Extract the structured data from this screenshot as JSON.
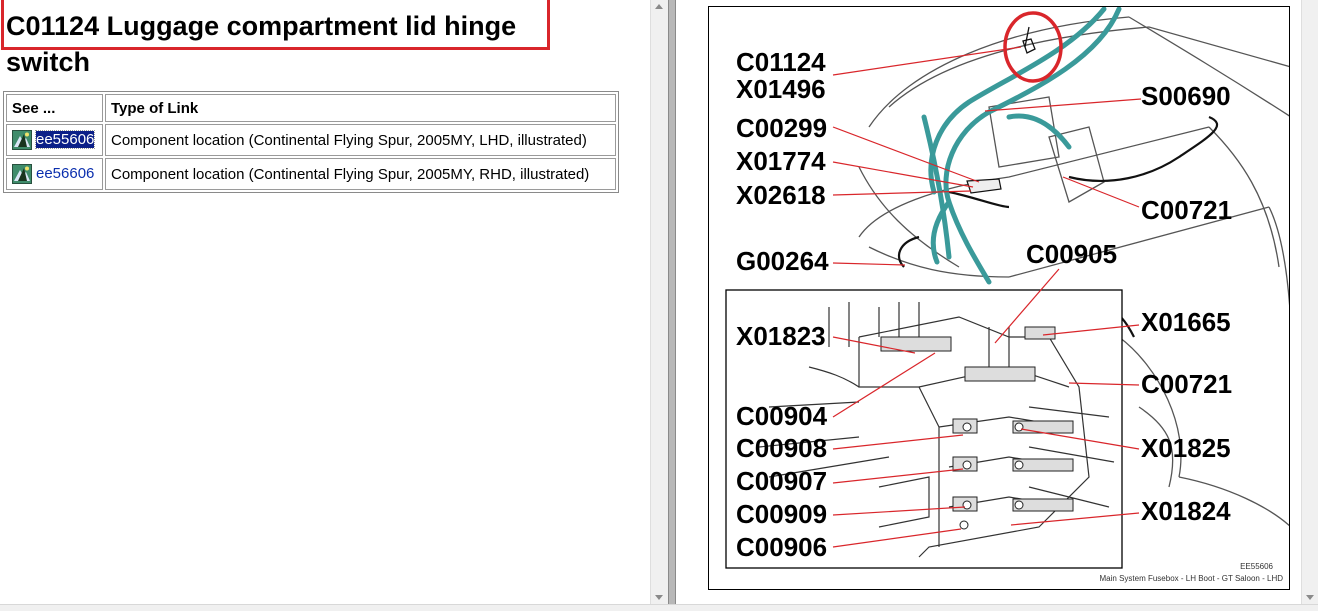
{
  "page": {
    "title": "C01124 Luggage compartment lid hinge switch"
  },
  "table": {
    "headers": [
      "See ...",
      "Type of Link"
    ],
    "rows": [
      {
        "link": "ee55606",
        "type": "Component location (Continental Flying Spur, 2005MY, LHD, illustrated)",
        "selected": true
      },
      {
        "link": "ee56606",
        "type": "Component location (Continental Flying Spur, 2005MY, RHD, illustrated)",
        "selected": false
      }
    ]
  },
  "diagram": {
    "labels": {
      "c01124": "C01124",
      "x01496": "X01496",
      "s00690": "S00690",
      "c00299": "C00299",
      "x01774": "X01774",
      "x02618": "X02618",
      "c00721_top": "C00721",
      "g00264": "G00264",
      "c00905": "C00905",
      "x01823": "X01823",
      "x01665": "X01665",
      "c00721_bottom": "C00721",
      "c00904": "C00904",
      "c00908": "C00908",
      "x01825": "X01825",
      "c00907": "C00907",
      "c00909": "C00909",
      "x01824": "X01824",
      "c00906": "C00906"
    },
    "ref_code": "EE55606",
    "caption": "Main System Fusebox - LH Boot - GT Saloon - LHD"
  },
  "colors": {
    "highlight_border": "#d9262b",
    "wiring": "#3a9a9a",
    "leader_line": "#d9262b",
    "link": "#0b2fae",
    "selection": "#0b1f88"
  }
}
